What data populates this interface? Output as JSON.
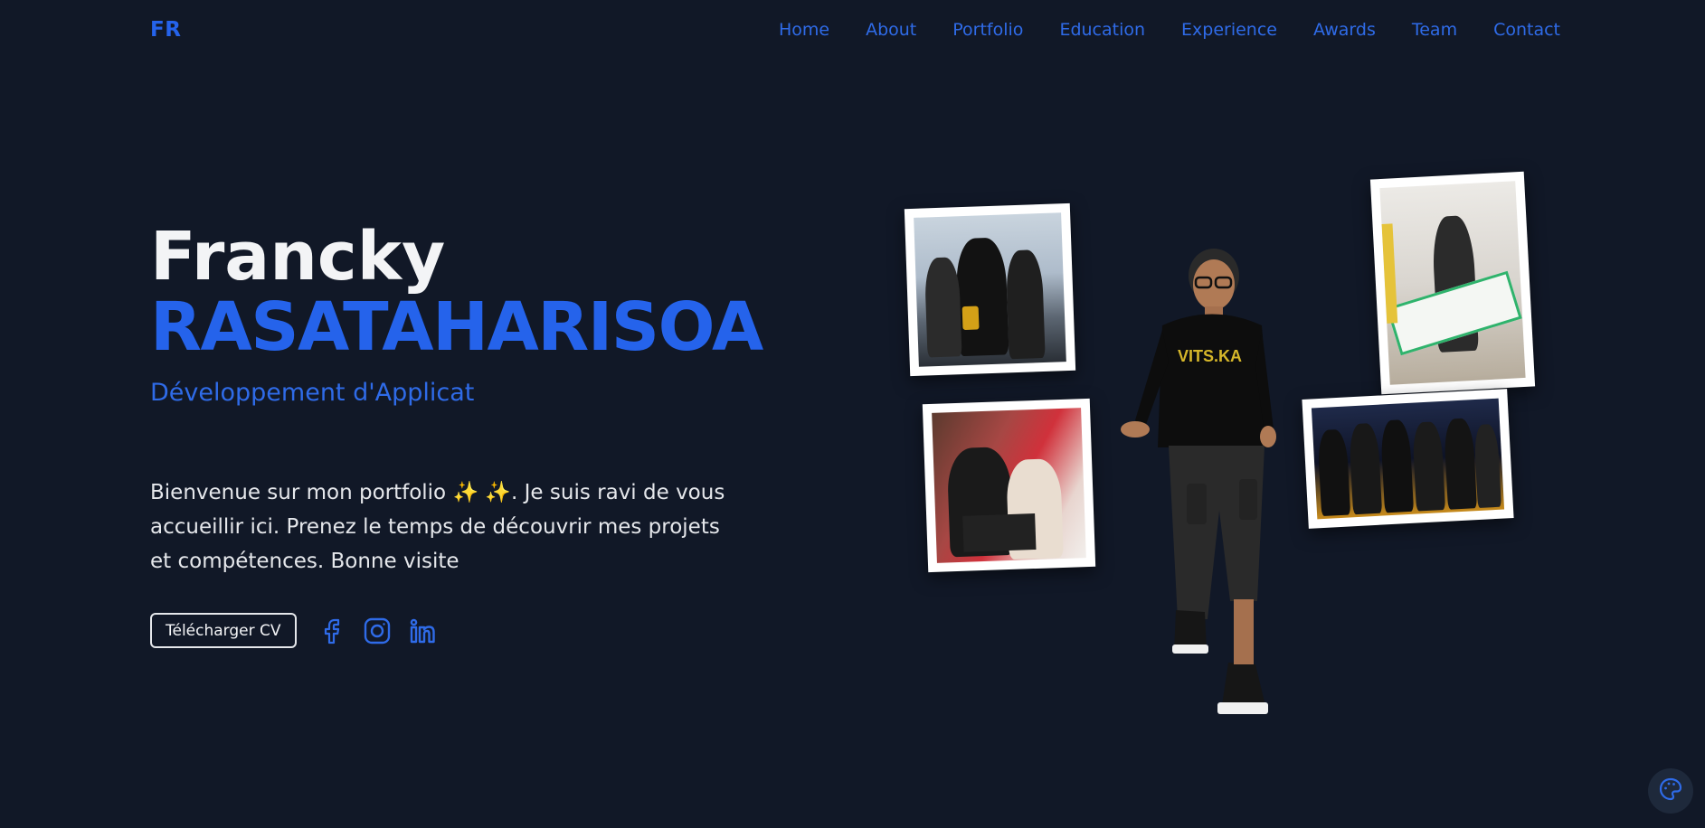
{
  "nav": {
    "logo": "FR",
    "links": [
      "Home",
      "About",
      "Portfolio",
      "Education",
      "Experience",
      "Awards",
      "Team",
      "Contact"
    ]
  },
  "hero": {
    "first_name": "Francky",
    "last_name": "RASATAHARISOA",
    "role": "Développement d'Applicat",
    "intro": "Bienvenue sur mon portfolio ✨ ✨. Je suis ravi de vous accueillir ici. Prenez le temps de découvrir mes projets et compétences. Bonne visite"
  },
  "actions": {
    "cv_label": "Télécharger CV",
    "social_icons": [
      "facebook-icon",
      "instagram-icon",
      "linkedin-icon"
    ]
  },
  "colors": {
    "background": "#111827",
    "accent": "#2563eb",
    "text": "#e5e7eb"
  }
}
